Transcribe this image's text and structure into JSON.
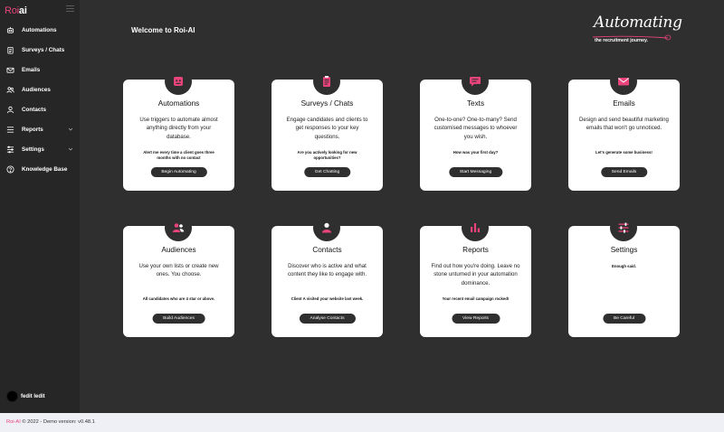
{
  "app": {
    "logo_left": "Roi",
    "logo_right": "ai"
  },
  "sidebar": {
    "items": [
      {
        "label": "Automations",
        "icon": "robot-icon"
      },
      {
        "label": "Surveys / Chats",
        "icon": "clipboard-icon"
      },
      {
        "label": "Emails",
        "icon": "envelope-icon"
      },
      {
        "label": "Audiences",
        "icon": "users-icon"
      },
      {
        "label": "Contacts",
        "icon": "user-icon"
      },
      {
        "label": "Reports",
        "icon": "chart-icon",
        "expandable": true
      },
      {
        "label": "Settings",
        "icon": "sliders-icon",
        "expandable": true
      },
      {
        "label": "Knowledge Base",
        "icon": "help-icon"
      }
    ],
    "user_name": "fedit ledit"
  },
  "main": {
    "welcome": "Welcome to Roi-AI",
    "brand_script": "Automating",
    "brand_tagline": "the recruitment journey.",
    "cards": [
      {
        "title": "Automations",
        "desc": "Use triggers to automate almost anything directly from your database.",
        "tip": "Alert me every time a client goes three months with no contact",
        "button": "Begin Automating",
        "icon": "robot-icon"
      },
      {
        "title": "Surveys / Chats",
        "desc": "Engage candidates and clients to get responses to your key questions.",
        "tip": "Are you actively looking for new opportunities?",
        "button": "Get Chatting",
        "icon": "clipboard-icon"
      },
      {
        "title": "Texts",
        "desc": "One-to-one? One-to-many? Send customised messages to whoever you wish.",
        "tip": "How was your first day?",
        "button": "Start Messaging",
        "icon": "message-icon"
      },
      {
        "title": "Emails",
        "desc": "Design and send beautiful marketing emails that won't go unnoticed.",
        "tip": "Let's generate some business!",
        "button": "Send Emails",
        "icon": "envelope-icon"
      },
      {
        "title": "Audiences",
        "desc": "Use your own lists or create new ones. You choose.",
        "tip": "All candidates who are 4 star or above.",
        "button": "Build Audiences",
        "icon": "users-icon"
      },
      {
        "title": "Contacts",
        "desc": "Discover who is active and what content they like to engage with.",
        "tip": "Client A visited your website last week.",
        "button": "Analyse Contacts",
        "icon": "user-icon"
      },
      {
        "title": "Reports",
        "desc": "Find out how you're doing. Leave no stone unturned in your automation dominance.",
        "tip": "Your recent email campaign rocked!",
        "button": "View Reports",
        "icon": "chart-icon"
      },
      {
        "title": "Settings",
        "desc": "",
        "tip": "Enough said.",
        "button": "Be Careful",
        "icon": "sliders-icon"
      }
    ]
  },
  "footer": {
    "brand": "Roi-AI",
    "text": " © 2022 - Demo version: v0.48.1"
  },
  "colors": {
    "accent": "#e8437a",
    "sidebar": "#262626",
    "background": "#2f2f2f",
    "card": "#ffffff"
  }
}
